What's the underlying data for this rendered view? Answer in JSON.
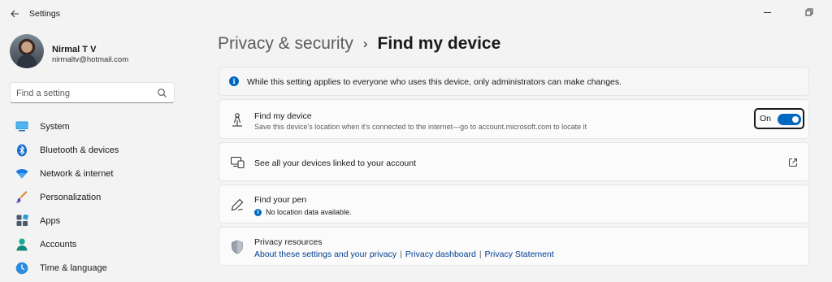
{
  "window": {
    "title": "Settings"
  },
  "profile": {
    "name": "Nirmal T V",
    "email": "nirmaltv@hotmail.com"
  },
  "search": {
    "placeholder": "Find a setting"
  },
  "sidebar": {
    "items": [
      {
        "label": "System",
        "icon": "system-icon"
      },
      {
        "label": "Bluetooth & devices",
        "icon": "bluetooth-icon"
      },
      {
        "label": "Network & internet",
        "icon": "wifi-icon"
      },
      {
        "label": "Personalization",
        "icon": "brush-icon"
      },
      {
        "label": "Apps",
        "icon": "apps-icon"
      },
      {
        "label": "Accounts",
        "icon": "accounts-icon"
      },
      {
        "label": "Time & language",
        "icon": "globe-clock-icon"
      }
    ]
  },
  "breadcrumb": {
    "parent": "Privacy & security",
    "separator": "›",
    "current": "Find my device"
  },
  "info_banner": {
    "text": "While this setting applies to everyone who uses this device, only administrators can make changes."
  },
  "find_my_device": {
    "title": "Find my device",
    "description": "Save this device's location when it's connected to the internet—go to account.microsoft.com to locate it",
    "toggle_label": "On",
    "toggle_on": true
  },
  "linked_devices": {
    "title": "See all your devices linked to your account"
  },
  "find_pen": {
    "title": "Find your pen",
    "status": "No location data available."
  },
  "privacy_resources": {
    "title": "Privacy resources",
    "links": [
      "About these settings and your privacy",
      "Privacy dashboard",
      "Privacy Statement"
    ],
    "separator": "|"
  },
  "colors": {
    "accent": "#0067c0",
    "link": "#003e92",
    "background": "#f3f3f3",
    "card": "#fbfbfb"
  }
}
